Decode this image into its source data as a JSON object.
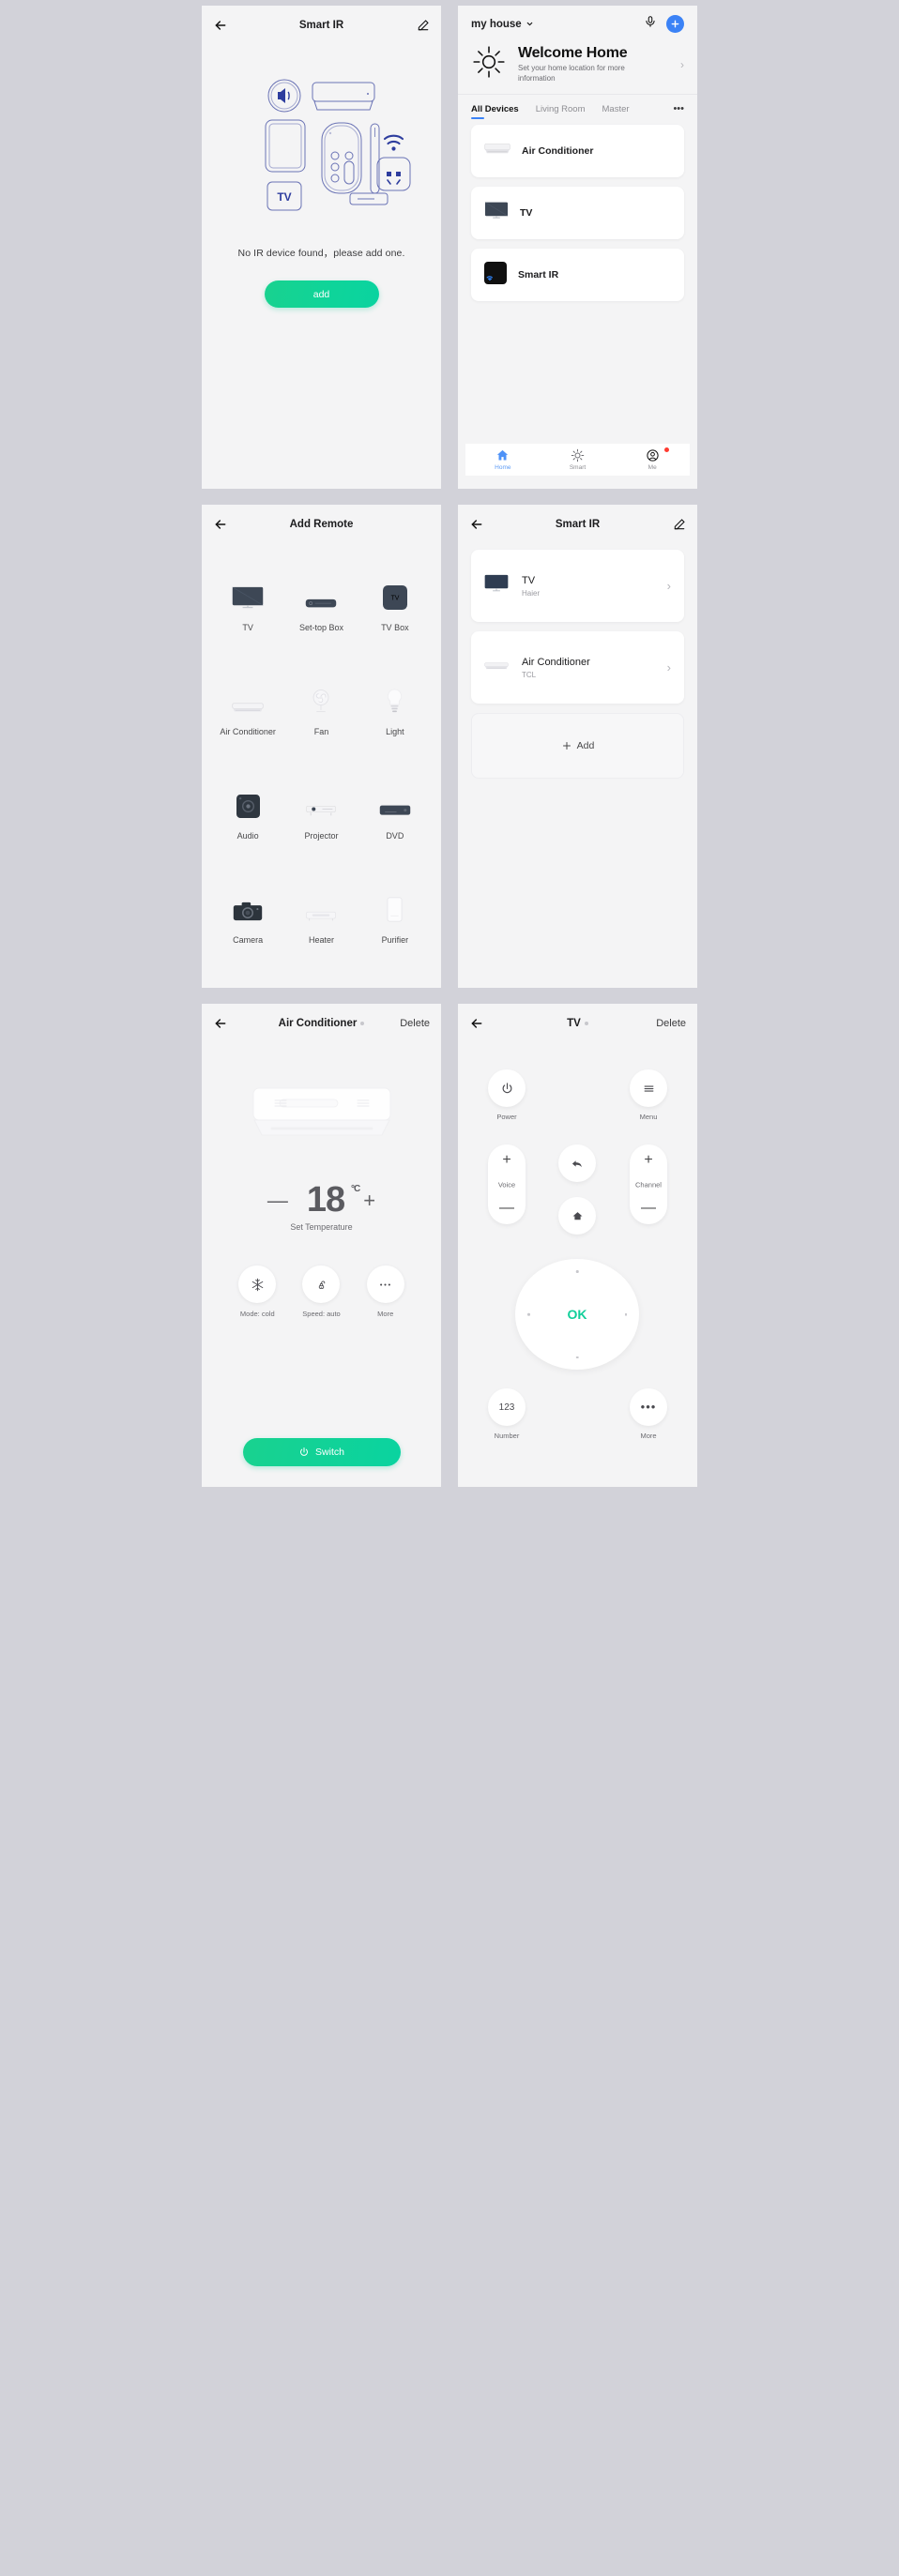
{
  "panel1": {
    "title": "Smart IR",
    "back_icon": "back-arrow-icon",
    "edit_icon": "pencil-edit-icon",
    "illustration_alt": "ir-devices-illustration",
    "tv_tag": "TV",
    "empty_text": "No IR device found，please add one.",
    "add_label": "add"
  },
  "panel2": {
    "house_name": "my house",
    "mic_icon": "microphone-icon",
    "add_icon": "plus-icon",
    "weather_icon": "sun-icon",
    "welcome_title": "Welcome Home",
    "welcome_sub": "Set your home location for more information",
    "chevron": "›",
    "tabs": [
      {
        "label": "All Devices",
        "active": true
      },
      {
        "label": "Living Room",
        "active": false
      },
      {
        "label": "Master",
        "active": false
      }
    ],
    "more_dots": "•••",
    "devices": [
      {
        "name": "Air Conditioner",
        "icon": "air-conditioner-icon"
      },
      {
        "name": "TV",
        "icon": "tv-icon"
      },
      {
        "name": "Smart IR",
        "icon": "smart-ir-icon"
      }
    ],
    "nav": [
      {
        "label": "Home",
        "icon": "home-icon",
        "active": true,
        "badge": false
      },
      {
        "label": "Smart",
        "icon": "sun-icon",
        "active": false,
        "badge": false
      },
      {
        "label": "Me",
        "icon": "person-icon",
        "active": false,
        "badge": true
      }
    ]
  },
  "panel3": {
    "title": "Add Remote",
    "back_icon": "back-arrow-icon",
    "items": [
      {
        "label": "TV",
        "icon": "tv-icon"
      },
      {
        "label": "Set-top Box",
        "icon": "set-top-box-icon"
      },
      {
        "label": "TV Box",
        "icon": "tv-box-icon"
      },
      {
        "label": "Air Conditioner",
        "icon": "air-conditioner-icon"
      },
      {
        "label": "Fan",
        "icon": "fan-icon"
      },
      {
        "label": "Light",
        "icon": "light-bulb-icon"
      },
      {
        "label": "Audio",
        "icon": "audio-icon"
      },
      {
        "label": "Projector",
        "icon": "projector-icon"
      },
      {
        "label": "DVD",
        "icon": "dvd-icon"
      },
      {
        "label": "Camera",
        "icon": "camera-icon"
      },
      {
        "label": "Heater",
        "icon": "heater-icon"
      },
      {
        "label": "Purifier",
        "icon": "purifier-icon"
      }
    ]
  },
  "panel4": {
    "title": "Smart IR",
    "back_icon": "back-arrow-icon",
    "edit_icon": "pencil-edit-icon",
    "remotes": [
      {
        "name": "TV",
        "brand": "Haier",
        "icon": "tv-icon"
      },
      {
        "name": "Air Conditioner",
        "brand": "TCL",
        "icon": "air-conditioner-icon"
      }
    ],
    "add_label": "Add",
    "add_icon": "plus-icon"
  },
  "panel5": {
    "title": "Air Conditioner",
    "back_icon": "back-arrow-icon",
    "delete_label": "Delete",
    "device_image": "air-conditioner-image",
    "minus": "—",
    "plus": "+",
    "temperature": "18",
    "unit": "°C",
    "temp_label": "Set Temperature",
    "modes": [
      {
        "label": "Mode: cold",
        "icon": "snowflake-icon"
      },
      {
        "label": "Speed: auto",
        "icon": "fan-speed-icon"
      },
      {
        "label": "More",
        "icon": "more-dots-icon"
      }
    ],
    "switch_label": "Switch",
    "switch_icon": "power-icon"
  },
  "panel6": {
    "title": "TV",
    "back_icon": "back-arrow-icon",
    "delete_label": "Delete",
    "power": {
      "label": "Power",
      "icon": "power-icon"
    },
    "menu": {
      "label": "Menu",
      "icon": "hamburger-menu-icon"
    },
    "voice": {
      "label": "Voice",
      "plus": "+",
      "minus": "—"
    },
    "channel": {
      "label": "Channel",
      "plus": "+",
      "minus": "—"
    },
    "back_btn": {
      "icon": "back-curve-arrow-icon"
    },
    "home_btn": {
      "icon": "home-arrow-icon"
    },
    "ok": "OK",
    "number": {
      "label": "Number",
      "value": "123"
    },
    "more": {
      "label": "More",
      "value": "•••"
    }
  },
  "colors": {
    "accent_green": "#12cf9a",
    "accent_blue": "#3b82f6",
    "illustration": "#5a62a8"
  }
}
